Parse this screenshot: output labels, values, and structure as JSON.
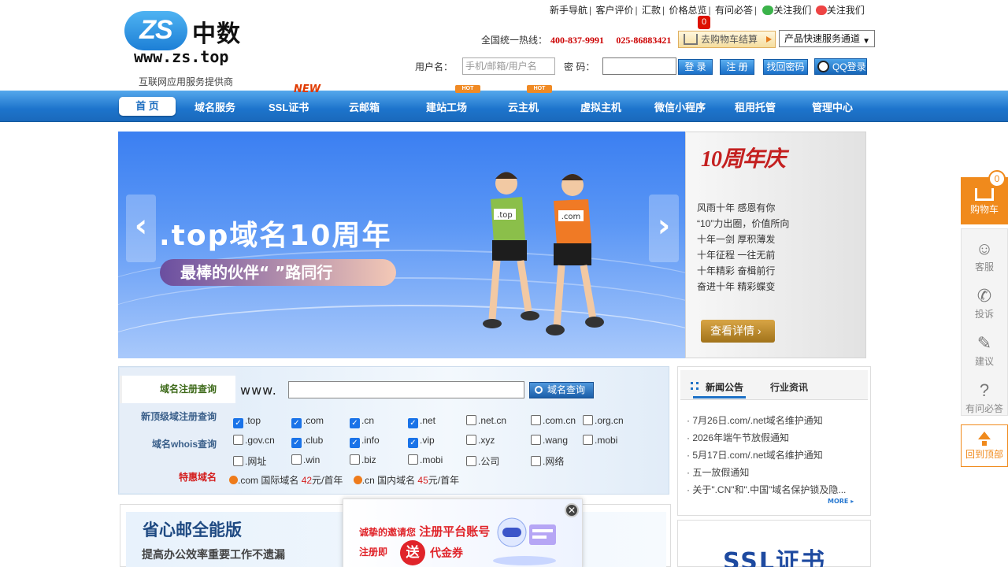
{
  "header": {
    "logo_badge": "ZS",
    "logo_cn": "中数",
    "logo_url": "www.zs.top",
    "slogan": "互联网应用服务提供商",
    "top_links": [
      "新手导航",
      "客户评价",
      "汇款",
      "价格总览",
      "有问必答"
    ],
    "follow_wechat": "关注我们",
    "follow_weibo": "关注我们",
    "hotline_label": "全国统一热线：",
    "hotline_1": "400-837-9991",
    "hotline_2": "025-86883421",
    "cart_label": "去购物车结算",
    "cart_count": "0",
    "service_select": "产品快速服务通道",
    "user_label": "用户名：",
    "user_placeholder": "手机/邮箱/用户名",
    "pwd_label": "密 码：",
    "login": "登 录",
    "register": "注 册",
    "find_pwd": "找回密码",
    "qq_login": "QQ登录"
  },
  "nav": {
    "items": [
      "首 页",
      "域名服务",
      "SSL证书",
      "云邮箱",
      "建站工场",
      "云主机",
      "虚拟主机",
      "微信小程序",
      "租用托管",
      "管理中心"
    ],
    "new_tag": "NEW",
    "hot_tag": "HOT"
  },
  "banner": {
    "title": ".top域名10周年",
    "pill": "最棒的伙伴“ ”路同行",
    "runner_left_tag": ".top",
    "runner_right_tag": ".com",
    "prev": "‹",
    "next": "›"
  },
  "aside": {
    "title": "10周年庆",
    "lines": [
      "风雨十年 感恩有你",
      "“10”力出圈，价值所向",
      "十年一剑 厚积薄发",
      "十年征程 一往无前",
      "十年精彩 奋楫前行",
      "奋进十年 精彩蝶变"
    ],
    "button": "查看详情"
  },
  "domain": {
    "tabs": [
      "域名注册查询",
      "新顶级域注册查询",
      "域名whois查询",
      "特惠域名"
    ],
    "www": "www.",
    "search_btn": "域名查询",
    "tlds": [
      {
        "name": ".top",
        "checked": true
      },
      {
        "name": ".com",
        "checked": true
      },
      {
        "name": ".cn",
        "checked": true
      },
      {
        "name": ".net",
        "checked": true
      },
      {
        "name": ".net.cn",
        "checked": false
      },
      {
        "name": ".com.cn",
        "checked": false
      },
      {
        "name": ".org.cn",
        "checked": false
      },
      {
        "name": ".gov.cn",
        "checked": false
      },
      {
        "name": ".club",
        "checked": true
      },
      {
        "name": ".info",
        "checked": true
      },
      {
        "name": ".vip",
        "checked": true
      },
      {
        "name": ".xyz",
        "checked": false
      },
      {
        "name": ".wang",
        "checked": false
      },
      {
        "name": ".mobi",
        "checked": false
      },
      {
        "name": ".网址",
        "checked": false
      },
      {
        "name": ".win",
        "checked": false
      },
      {
        "name": ".biz",
        "checked": false
      },
      {
        "name": ".mobi",
        "checked": false
      },
      {
        "name": ".公司",
        "checked": false
      },
      {
        "name": ".网络",
        "checked": false
      }
    ],
    "promo_1_name": ".com 国际域名",
    "promo_1_price": "42",
    "promo_1_unit": "元/首年",
    "promo_2_name": ".cn 国内域名",
    "promo_2_price": "45",
    "promo_2_unit": "元/首年"
  },
  "news": {
    "tab_active": "新闻公告",
    "tab_other": "行业资讯",
    "items": [
      "· 7月26日.com/.net域名维护通知",
      "· 2026年端午节放假通知",
      "· 5月17日.com/.net域名维护通知",
      "· 五一放假通知",
      "· 关于\".CN\"和\".中国\"域名保护锁及隐..."
    ],
    "more": "MORE"
  },
  "ssl": {
    "text": "SSL证书"
  },
  "mail": {
    "title": "省心邮全能版",
    "subtitle": "提高办公效率重要工作不遗漏"
  },
  "popup": {
    "line1_a": "诚挚的邀请您 ",
    "line1_b": "注册平台账号",
    "line2": "注册即",
    "send": "送",
    "coupon": "代金券",
    "close": "✕"
  },
  "float": {
    "cart": "购物车",
    "cart_count": "0",
    "items": [
      "客服",
      "投诉",
      "建议",
      "有问必答"
    ],
    "top": "回到顶部"
  },
  "colors": {
    "nav_blue": "#1d74cc",
    "hotline_red": "#cc0000",
    "accent_orange": "#f08a1c"
  }
}
